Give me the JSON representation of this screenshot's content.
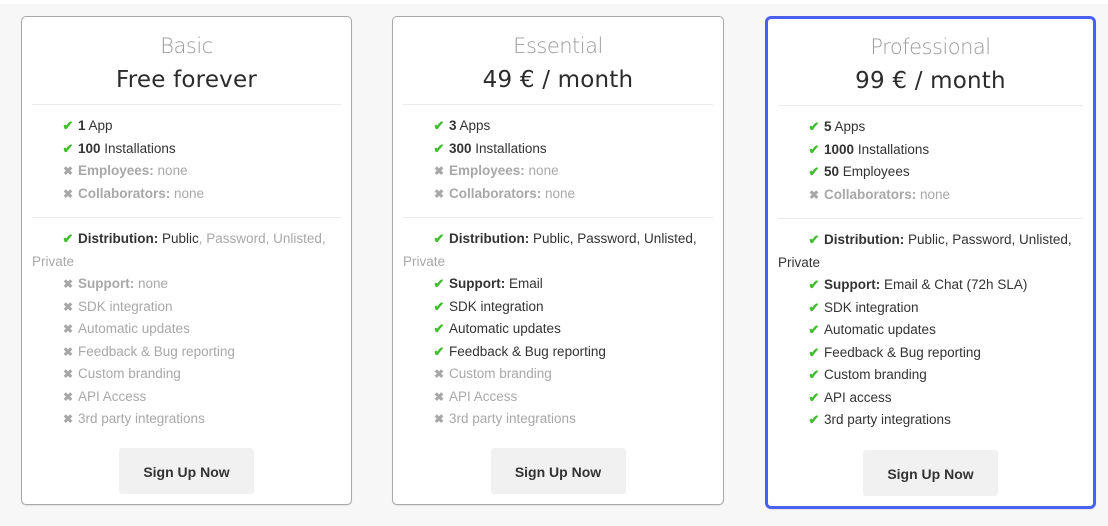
{
  "plans": [
    {
      "id": "basic",
      "name": "Basic",
      "price": "Free forever",
      "highlighted": false,
      "limits": [
        {
          "included": true,
          "value": "1",
          "label": "App"
        },
        {
          "included": true,
          "value": "100",
          "label": "Installations"
        },
        {
          "included": false,
          "key": "Employees:",
          "label": "none"
        },
        {
          "included": false,
          "key": "Collaborators:",
          "label": "none"
        }
      ],
      "distribution": {
        "included": true,
        "key": "Distribution:",
        "enabled": "Public",
        "disabled": ", Password, Unlisted,",
        "disabled_cont": "Private"
      },
      "features": [
        {
          "included": false,
          "key": "Support:",
          "label": "none"
        },
        {
          "included": false,
          "label": "SDK integration"
        },
        {
          "included": false,
          "label": "Automatic updates"
        },
        {
          "included": false,
          "label": "Feedback & Bug reporting"
        },
        {
          "included": false,
          "label": "Custom branding"
        },
        {
          "included": false,
          "label": "API Access"
        },
        {
          "included": false,
          "label": "3rd party integrations"
        }
      ],
      "button": "Sign Up Now"
    },
    {
      "id": "essential",
      "name": "Essential",
      "price": "49 € / month",
      "highlighted": false,
      "limits": [
        {
          "included": true,
          "value": "3",
          "label": "Apps"
        },
        {
          "included": true,
          "value": "300",
          "label": "Installations"
        },
        {
          "included": false,
          "key": "Employees:",
          "label": "none"
        },
        {
          "included": false,
          "key": "Collaborators:",
          "label": "none"
        }
      ],
      "distribution": {
        "included": true,
        "key": "Distribution:",
        "enabled": "Public, Password, Unlisted,",
        "disabled": "",
        "disabled_cont": "Private"
      },
      "features": [
        {
          "included": true,
          "key": "Support:",
          "label": "Email"
        },
        {
          "included": true,
          "label": "SDK integration"
        },
        {
          "included": true,
          "label": "Automatic updates"
        },
        {
          "included": true,
          "label": "Feedback & Bug reporting"
        },
        {
          "included": false,
          "label": "Custom branding"
        },
        {
          "included": false,
          "label": "API Access"
        },
        {
          "included": false,
          "label": "3rd party integrations"
        }
      ],
      "button": "Sign Up Now"
    },
    {
      "id": "professional",
      "name": "Professional",
      "price": "99 € / month",
      "highlighted": true,
      "limits": [
        {
          "included": true,
          "value": "5",
          "label": "Apps"
        },
        {
          "included": true,
          "value": "1000",
          "label": "Installations"
        },
        {
          "included": true,
          "value": "50",
          "label": "Employees"
        },
        {
          "included": false,
          "key": "Collaborators:",
          "label": "none"
        }
      ],
      "distribution": {
        "included": true,
        "key": "Distribution:",
        "enabled": "Public, Password, Unlisted,",
        "enabled_cont": "Private",
        "disabled": ""
      },
      "features": [
        {
          "included": true,
          "key": "Support:",
          "label": "Email & Chat (72h SLA)"
        },
        {
          "included": true,
          "label": "SDK integration"
        },
        {
          "included": true,
          "label": "Automatic updates"
        },
        {
          "included": true,
          "label": "Feedback & Bug reporting"
        },
        {
          "included": true,
          "label": "Custom branding"
        },
        {
          "included": true,
          "label": "API access"
        },
        {
          "included": true,
          "label": "3rd party integrations"
        }
      ],
      "button": "Sign Up Now"
    }
  ],
  "icons": {
    "check": "✔",
    "cross": "✖"
  },
  "colors": {
    "check": "#3fbf2b",
    "muted": "#a8a8a8",
    "highlight_border": "#4a61f0",
    "button_bg": "#f1f1f1"
  }
}
